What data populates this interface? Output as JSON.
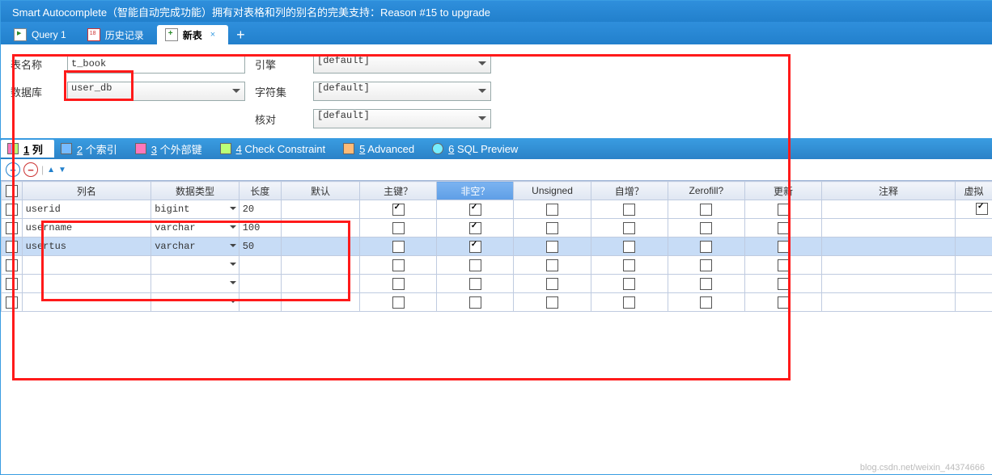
{
  "banner": "Smart Autocomplete（智能自动完成功能）拥有对表格和列的别名的完美支持：Reason #15 to upgrade",
  "tabs": [
    {
      "label": "Query 1",
      "icon": "query",
      "active": false
    },
    {
      "label": "历史记录",
      "icon": "history",
      "active": false
    },
    {
      "label": "新表",
      "icon": "newtab",
      "active": true
    }
  ],
  "form": {
    "table_name_label": "表名称",
    "table_name_value": "t_book",
    "database_label": "数据库",
    "database_value": "user_db",
    "engine_label": "引擎",
    "engine_value": "[default]",
    "charset_label": "字符集",
    "charset_value": "[default]",
    "collation_label": "核对",
    "collation_value": "[default]"
  },
  "subtabs": [
    {
      "label": "1 列",
      "icon": "col",
      "active": true,
      "ul": "1"
    },
    {
      "label": "2 个索引",
      "icon": "idx",
      "ul": "2"
    },
    {
      "label": "3 个外部键",
      "icon": "fk",
      "ul": "3"
    },
    {
      "label": "4 Check Constraint",
      "icon": "chk",
      "ul": "4"
    },
    {
      "label": "5 Advanced",
      "icon": "adv",
      "ul": "5"
    },
    {
      "label": "6 SQL Preview",
      "icon": "sql",
      "ul": "6"
    }
  ],
  "grid": {
    "headers": {
      "name": "列名",
      "type": "数据类型",
      "len": "长度",
      "def": "默认",
      "pk": "主键？",
      "nn": "非空？",
      "unsigned": "Unsigned",
      "ai": "自增？",
      "zf": "Zerofill?",
      "upd": "更新",
      "comment": "注释",
      "virt": "虚拟"
    },
    "rows": [
      {
        "name": "userid",
        "type": "bigint",
        "len": "20",
        "def": "",
        "pk": true,
        "nn": true,
        "unsigned": false,
        "ai": false,
        "zf": false,
        "upd": false,
        "sel": false
      },
      {
        "name": "username",
        "type": "varchar",
        "len": "100",
        "def": "",
        "pk": false,
        "nn": true,
        "unsigned": false,
        "ai": false,
        "zf": false,
        "upd": false,
        "sel": false
      },
      {
        "name": "usertus",
        "type": "varchar",
        "len": "50",
        "def": "",
        "pk": false,
        "nn": true,
        "unsigned": false,
        "ai": false,
        "zf": false,
        "upd": false,
        "sel": true
      },
      {
        "name": "",
        "type": "",
        "len": "",
        "def": "",
        "pk": false,
        "nn": false,
        "unsigned": false,
        "ai": false,
        "zf": false,
        "upd": false,
        "sel": false
      },
      {
        "name": "",
        "type": "",
        "len": "",
        "def": "",
        "pk": false,
        "nn": false,
        "unsigned": false,
        "ai": false,
        "zf": false,
        "upd": false,
        "sel": false
      },
      {
        "name": "",
        "type": "",
        "len": "",
        "def": "",
        "pk": false,
        "nn": false,
        "unsigned": false,
        "ai": false,
        "zf": false,
        "upd": false,
        "sel": false
      }
    ]
  },
  "watermark": "blog.csdn.net/weixin_44374666"
}
